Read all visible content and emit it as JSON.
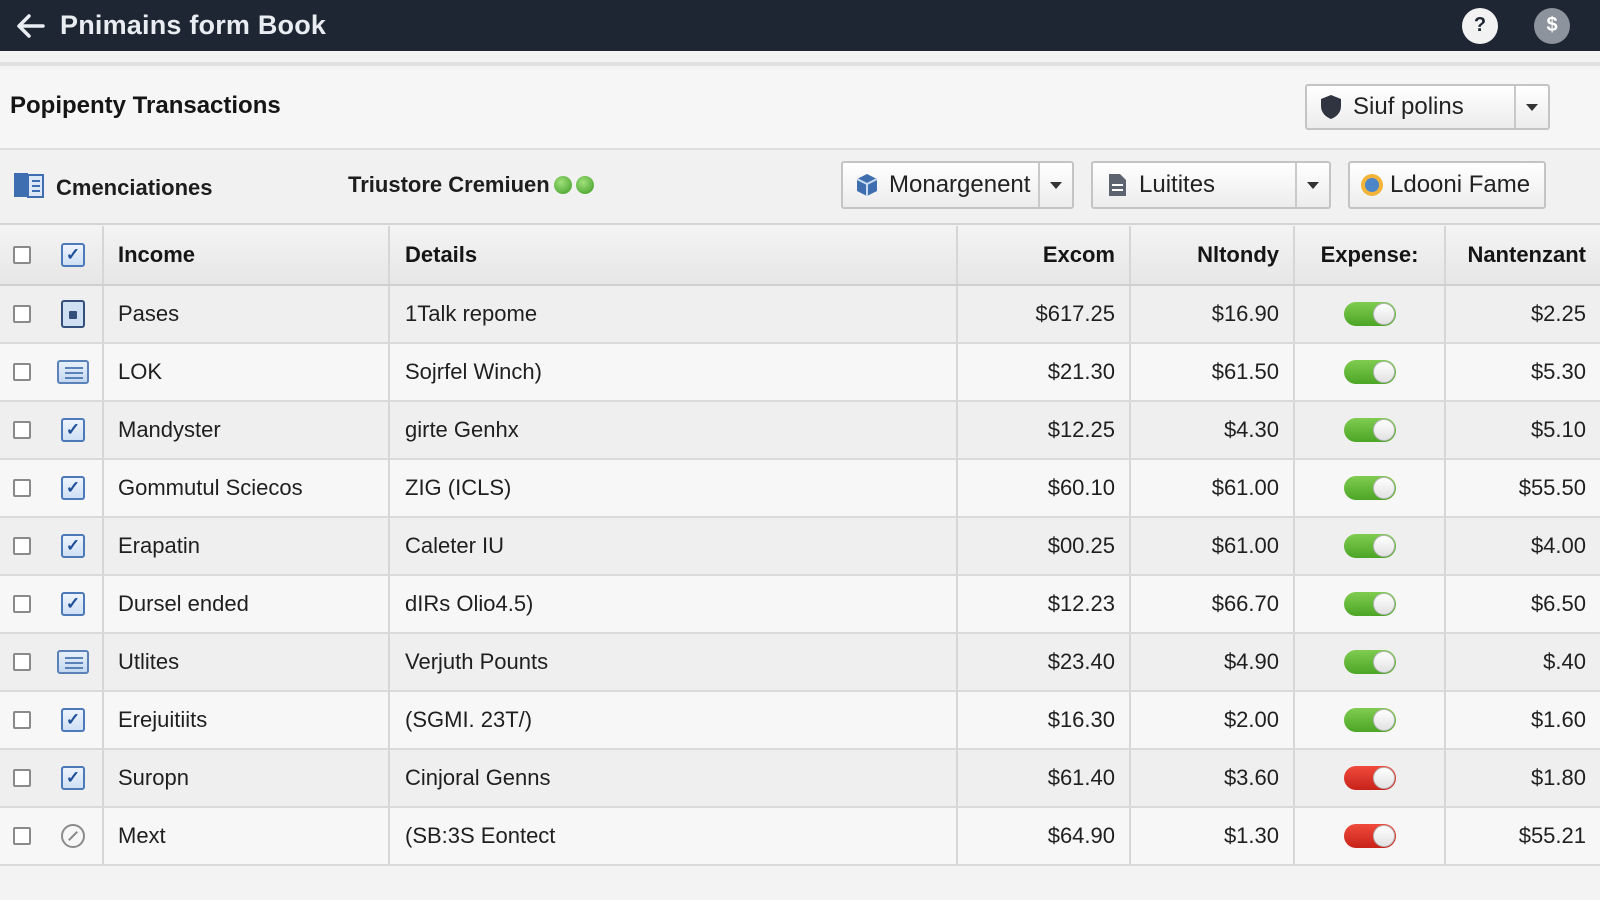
{
  "window": {
    "title": "Pnimains form Book"
  },
  "top_icons": {
    "help_glyph": "?",
    "dollar_glyph": "$"
  },
  "header": {
    "title": "Popipenty Transactions",
    "select_value": "Siuf polins"
  },
  "toolbar": {
    "left_label": "Cmenciationes",
    "mid_label": "Triustore Cremiuen",
    "dropdown1": "Monargenent",
    "dropdown2": "Luitites",
    "button3": "Ldooni Fame"
  },
  "table": {
    "columns": [
      "Income",
      "Details",
      "Excom",
      "Nltondy",
      "Expense:",
      "Nantenzant"
    ],
    "rows": [
      {
        "icon": "lock-icon",
        "income": "Pases",
        "details": "1Talk repome",
        "excom": "$617.25",
        "nltondy": "$16.90",
        "expense_on": true,
        "nantenzant": "$2.25"
      },
      {
        "icon": "list-icon",
        "income": "LOK",
        "details": "Sojrfel Winch)",
        "excom": "$21.30",
        "nltondy": "$61.50",
        "expense_on": true,
        "nantenzant": "$5.30"
      },
      {
        "icon": "check-icon",
        "income": "Mandyster",
        "details": "girte Genhx",
        "excom": "$12.25",
        "nltondy": "$4.30",
        "expense_on": true,
        "nantenzant": "$5.10"
      },
      {
        "icon": "check-icon",
        "income": "Gommutul Sciecos",
        "details": "ZIG (ICLS)",
        "excom": "$60.10",
        "nltondy": "$61.00",
        "expense_on": true,
        "nantenzant": "$55.50"
      },
      {
        "icon": "check-icon",
        "income": "Erapatin",
        "details": "Caleter IU",
        "excom": "$00.25",
        "nltondy": "$61.00",
        "expense_on": true,
        "nantenzant": "$4.00"
      },
      {
        "icon": "check-icon",
        "income": "Dursel ended",
        "details": "dIRs Olio4.5)",
        "excom": "$12.23",
        "nltondy": "$66.70",
        "expense_on": true,
        "nantenzant": "$6.50"
      },
      {
        "icon": "list-icon",
        "income": "Utlites",
        "details": "Verjuth Pounts",
        "excom": "$23.40",
        "nltondy": "$4.90",
        "expense_on": true,
        "nantenzant": "$.40"
      },
      {
        "icon": "check-icon",
        "income": "Erejuitiits",
        "details": "(SGMI. 23T/)",
        "excom": "$16.30",
        "nltondy": "$2.00",
        "expense_on": true,
        "nantenzant": "$1.60"
      },
      {
        "icon": "check-icon",
        "income": "Suropn",
        "details": "Cinjoral Genns",
        "excom": "$61.40",
        "nltondy": "$3.60",
        "expense_on": false,
        "nantenzant": "$1.80"
      },
      {
        "icon": "circle-slash-icon",
        "income": "Mext",
        "details": "(SB:3S Eontect",
        "excom": "$64.90",
        "nltondy": "$1.30",
        "expense_on": false,
        "nantenzant": "$55.21"
      }
    ]
  },
  "colors": {
    "topbar": "#1f2633",
    "toggle_on": "#4ca526",
    "toggle_off": "#c8231a"
  }
}
